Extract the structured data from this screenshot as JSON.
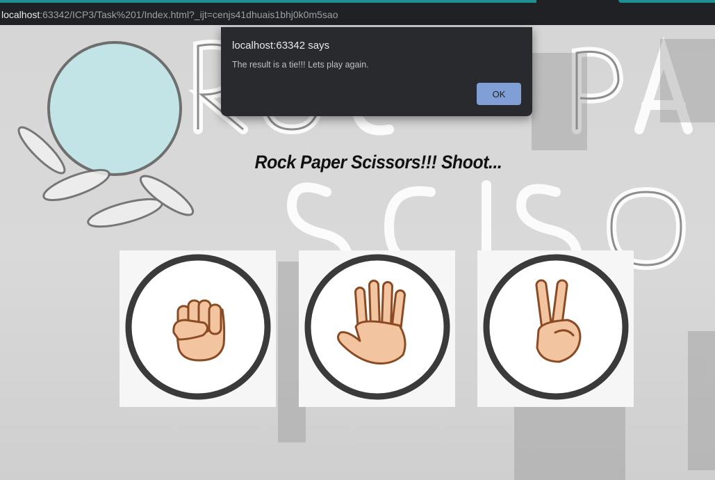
{
  "browser": {
    "url_host": "localhost",
    "url_rest": ":63342/ICP3/Task%201/Index.html?_ijt=cenjs41dhuais1bhj0k0m5sao"
  },
  "page": {
    "heading": "Rock Paper Scissors!!! Shoot...",
    "choices": [
      {
        "label": "Rock",
        "icon": "fist-icon"
      },
      {
        "label": "Paper",
        "icon": "open-hand-icon"
      },
      {
        "label": "Scissors",
        "icon": "peace-sign-icon"
      }
    ]
  },
  "dialog": {
    "title": "localhost:63342 says",
    "message": "The result is a tie!!! Lets play again.",
    "ok_label": "OK"
  },
  "colors": {
    "dialog_bg": "#292a2d",
    "ok_button": "#7f9fd6",
    "skin": "#f2c4a0",
    "skin_outline": "#8a4b24",
    "circle_ring": "#3a3a3a"
  }
}
